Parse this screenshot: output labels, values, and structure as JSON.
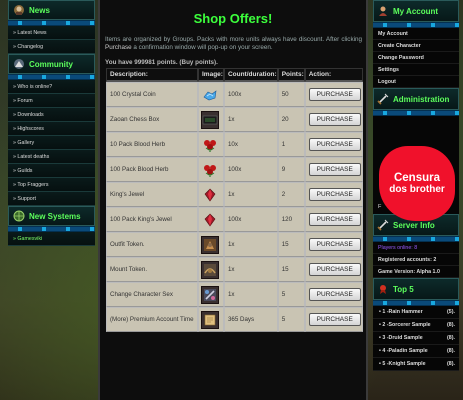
{
  "left": {
    "news_title": "News",
    "news_items": [
      "» Latest News",
      "» Changelog"
    ],
    "community_title": "Community",
    "community_items": [
      "» Who is online?",
      "» Forum",
      "» Downloads",
      "» Highscores",
      "» Gallery",
      "» Latest deaths",
      "» Guilds",
      "» Top Fraggers",
      "» Support"
    ],
    "systems_title": "New Systems",
    "systems_items": [
      "» Gamesviki"
    ]
  },
  "main": {
    "title": "Shop Offers!",
    "intro_1": "Items are organized by Groups. Packs with more units always have discount. After clicking",
    "intro_link": "Purchase",
    "intro_2": "a confirmation window will pop-up on your screen.",
    "points": "You have 999981 points. (Buy points).",
    "columns": [
      "Description:",
      "Image:",
      "Count/duration:",
      "Points:",
      "Action:"
    ],
    "items": [
      {
        "description": "100 Crystal Coin",
        "count": "100x",
        "points": "50",
        "action": "PURCHASE",
        "icon": "crystal-coin-icon"
      },
      {
        "description": "Zaoan Chess Box",
        "count": "1x",
        "points": "20",
        "action": "PURCHASE",
        "icon": "chess-box-icon"
      },
      {
        "description": "10 Pack Blood Herb",
        "count": "10x",
        "points": "1",
        "action": "PURCHASE",
        "icon": "blood-herb-icon"
      },
      {
        "description": "100 Pack Blood Herb",
        "count": "100x",
        "points": "9",
        "action": "PURCHASE",
        "icon": "blood-herb-icon"
      },
      {
        "description": "King's Jewel",
        "count": "1x",
        "points": "2",
        "action": "PURCHASE",
        "icon": "kings-jewel-icon"
      },
      {
        "description": "100 Pack King's Jewel",
        "count": "100x",
        "points": "120",
        "action": "PURCHASE",
        "icon": "kings-jewel-icon"
      },
      {
        "description": "Outfit Token.",
        "count": "1x",
        "points": "15",
        "action": "PURCHASE",
        "icon": "outfit-token-icon"
      },
      {
        "description": "Mount Token.",
        "count": "1x",
        "points": "15",
        "action": "PURCHASE",
        "icon": "mount-token-icon"
      },
      {
        "description": "Change Character Sex",
        "count": "1x",
        "points": "5",
        "action": "PURCHASE",
        "icon": "change-sex-icon"
      },
      {
        "description": "(More) Premium Account Time",
        "count": "365 Days",
        "points": "5",
        "action": "PURCHASE",
        "icon": "premium-scroll-icon"
      }
    ]
  },
  "right": {
    "account_title": "My Account",
    "account_items": [
      "My Account",
      "Create Character",
      "Change Password",
      "Settings",
      "Logout"
    ],
    "admin_title": "Administration",
    "admin_fragment": "F",
    "censor_line1": "Censura",
    "censor_line2": "dos brother",
    "server_title": "Server Info",
    "players_online": "Players online: 8",
    "registered": "Registered accounts: 2",
    "version": "Game Version: Alpha 1.0",
    "top5_title": "Top 5",
    "top5": [
      {
        "name": "• 1 -Rain Hammer",
        "level": "(5)."
      },
      {
        "name": "• 2 -Sorcerer Sample",
        "level": "(8)."
      },
      {
        "name": "• 3 -Druid Sample",
        "level": "(8)."
      },
      {
        "name": "• 4 -Paladin Sample",
        "level": "(8)."
      },
      {
        "name": "• 5 -Knight Sample",
        "level": "(8)."
      }
    ]
  },
  "colors": {
    "accent_green": "#3cff3c",
    "link_green": "#7cff6a",
    "censor_red": "#f0112b",
    "row_bg": "#c9c4b3"
  }
}
